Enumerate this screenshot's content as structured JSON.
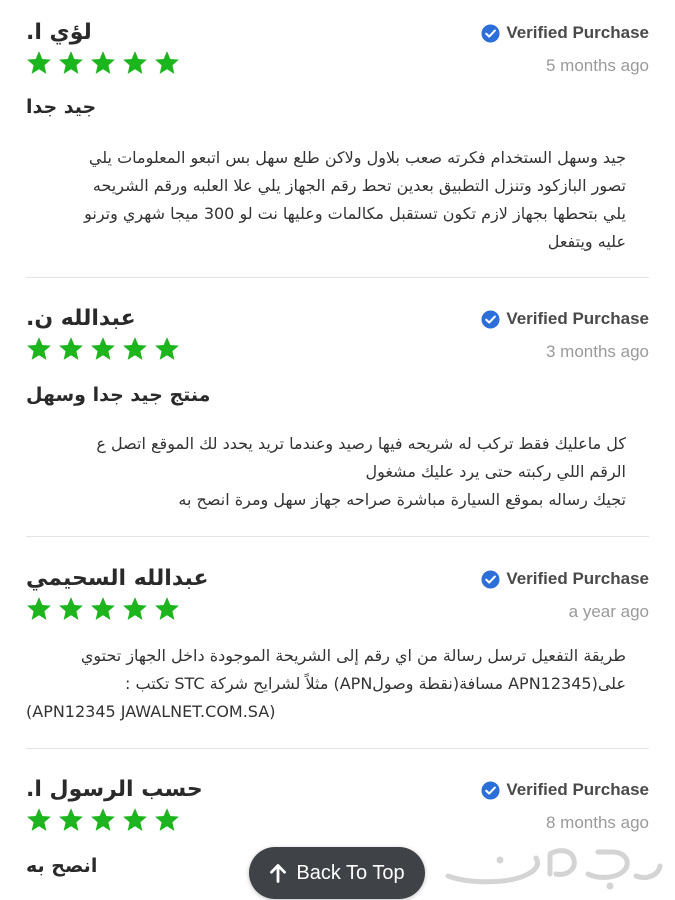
{
  "verified_icon": "check-circle-icon",
  "star_icon": "star-icon",
  "colors": {
    "star": "#1db51d",
    "verified_badge": "#2d6fd8",
    "date": "#9a9a9a",
    "back_to_top_bg": "#3f4246"
  },
  "reviews": [
    {
      "name": "لؤي ا.",
      "verified": "Verified Purchase",
      "rating": 5,
      "date": "5 months ago",
      "title": "جيد جدا",
      "body": [
        "جيد وسهل الستخدام فكرته صعب بلاول ولاكن طلع سهل بس اتبعو المعلومات يلي",
        "تصور البازكود وتنزل التطبيق بعدين تحط رقم الجهاز يلي علا العلبه ورقم الشريحه",
        "يلي بتحطها بجهاز لازم تكون تستقبل مكالمات وعليها نت لو 300 ميجا شهري وترنو",
        "عليه ويتفعل"
      ]
    },
    {
      "name": "عبدالله ن.",
      "verified": "Verified Purchase",
      "rating": 5,
      "date": "3 months ago",
      "title": "منتج جيد جدا وسهل",
      "body": [
        "كل ماعليك فقط تركب له شريحه فيها رصيد وعندما تريد يحدد لك الموقع اتصل ع",
        "الرقم اللي ركبته حتى  يرد عليك مشغول",
        "تجيك رساله بموقع السيارة مباشرة صراحه جهاز سهل ومرة انصح به"
      ]
    },
    {
      "name": "عبدالله السحيمي",
      "verified": "Verified Purchase",
      "rating": 5,
      "date": "a year ago",
      "title": "",
      "body": [
        "طريقة التفعيل ترسل رسالة من اي رقم إلى الشريحة الموجودة داخل الجهاز تحتوي",
        "على(APN12345 مسافة(نقطة وصولAPN) مثلاً لشرايح شركة STC تكتب :",
        "(APN12345 JAWALNET.COM.SA)"
      ]
    },
    {
      "name": "حسب الرسول ا.",
      "verified": "Verified Purchase",
      "rating": 5,
      "date": "8 months ago",
      "title": "انصح به",
      "body": []
    }
  ],
  "back_to_top": {
    "label": "Back To Top",
    "icon": "up-arrow-icon"
  },
  "watermark": {
    "icon": "haraj-logo-icon"
  }
}
